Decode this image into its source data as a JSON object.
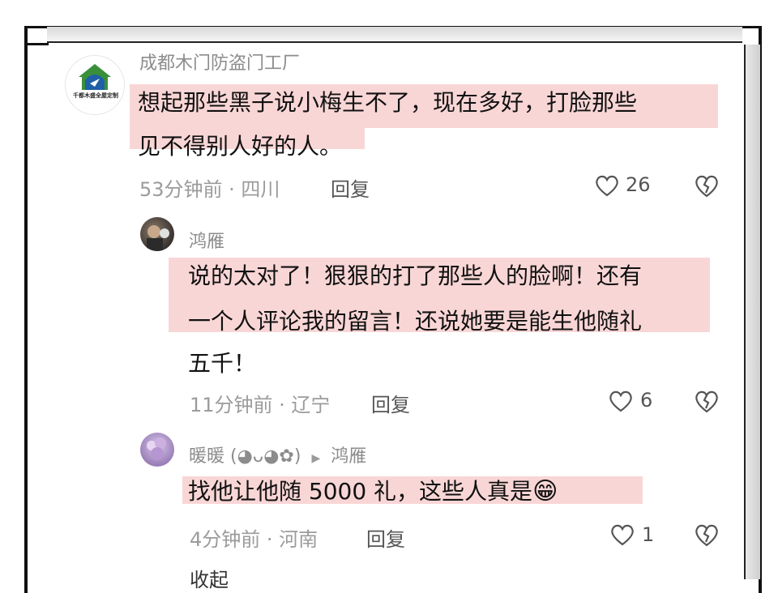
{
  "comments": [
    {
      "author": "成都木门防盗门工厂",
      "logo_text": "千都木盛全屋定制",
      "text_line1": "想起那些黑子说小梅生不了，现在多好，打脸那些",
      "text_line2": "见不得别人好的人。",
      "time_location": "53分钟前 · 四川",
      "reply_label": "回复",
      "likes": "26"
    },
    {
      "author": "鸿雁",
      "text_line1": "说的太对了！狠狠的打了那些人的脸啊！还有",
      "text_line2": "一个人评论我的留言！还说她要是能生他随礼",
      "text_line3": "五千！",
      "time_location": "11分钟前 · 辽宁",
      "reply_label": "回复",
      "likes": "6"
    },
    {
      "author": "暖暖 (◕ᴗ◕✿)",
      "reply_to_arrow": "▶",
      "reply_to": "鸿雁",
      "text": "找他让他随 5000 礼，这些人真是",
      "emoji": "😁",
      "time_location": "4分钟前 · 河南",
      "reply_label": "回复",
      "likes": "1"
    }
  ],
  "collapse_label": "收起",
  "icons": [
    "heart-outline-icon",
    "broken-heart-icon",
    "grin-emoji-icon"
  ],
  "colors": {
    "highlight": "#f9d6d6",
    "meta_text": "#9b9b9b",
    "author_text": "#8c8c8c"
  }
}
